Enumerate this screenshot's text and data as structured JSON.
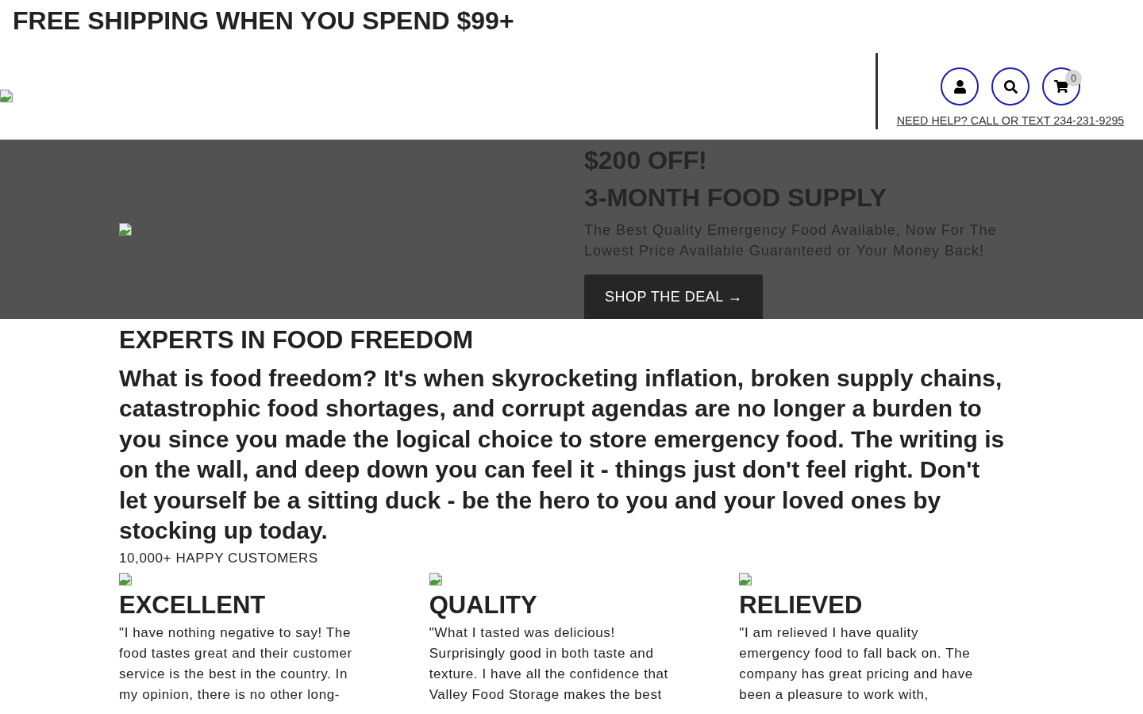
{
  "announcement": {
    "text": "FREE SHIPPING WHEN YOU SPEND $99+"
  },
  "header": {
    "cart_count": "0",
    "help_link": "NEED HELP? CALL OR TEXT 234-231-9295"
  },
  "hero": {
    "title_lines": [
      "$200 OFF!",
      "3-MONTH FOOD SUPPLY"
    ],
    "subtitle": "The Best Quality Emergency Food Available, Now For The\nLowest Price Available Guaranteed or Your Money Back!",
    "button": "SHOP THE DEAL →"
  },
  "intro": {
    "heading": "EXPERTS IN FOOD FREEDOM",
    "body": "What is food freedom? It's when skyrocketing inflation, broken supply chains,\ncatastrophic food shortages, and corrupt agendas are no longer a burden to\nyou since you made the logical choice to store emergency food. The writing is\non the wall, and deep down you can feel it - things just don't feel right. Don't\nlet yourself be a sitting duck - be the hero to you and your loved ones by\nstocking up today.",
    "customers": "10,000+ HAPPY CUSTOMERS"
  },
  "reviews": [
    {
      "title": "EXCELLENT",
      "quote": "\"I have nothing negative to say! The\nfood tastes great and their customer\nservice is the best in the country. In\nmy opinion, there is no other long-"
    },
    {
      "title": "QUALITY",
      "quote": "\"What I tasted was delicious!\nSurprisingly good in both taste and\ntexture. I have all the confidence that\nValley Food Storage makes the best"
    },
    {
      "title": "RELIEVED",
      "quote": "\"I am relieved I have quality\nemergency food to fall back on. The\ncompany has great pricing and have\nbeen a pleasure to work with,"
    }
  ]
}
